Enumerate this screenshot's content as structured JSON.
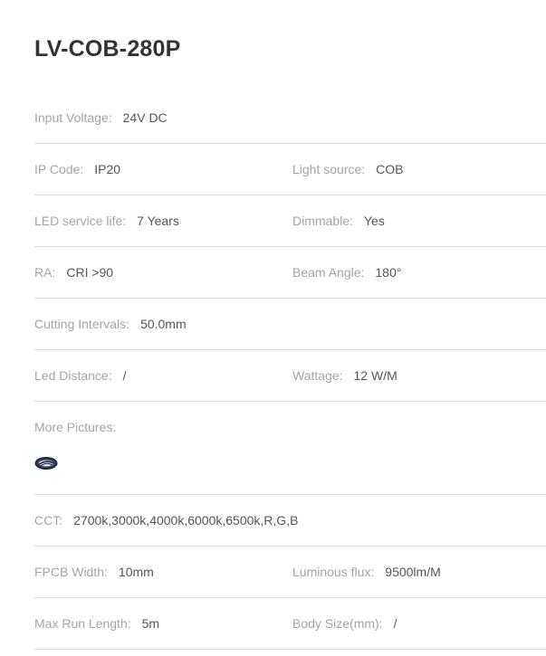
{
  "title": "LV-COB-280P",
  "rows": [
    {
      "left": {
        "label": "Input Voltage:",
        "value": "24V DC"
      }
    },
    {
      "left": {
        "label": "IP Code:",
        "value": "IP20"
      },
      "right": {
        "label": "Light source:",
        "value": "COB"
      }
    },
    {
      "left": {
        "label": "LED service life:",
        "value": "7 Years"
      },
      "right": {
        "label": "Dimmable:",
        "value": "Yes"
      }
    },
    {
      "left": {
        "label": "RA:",
        "value": "CRI >90"
      },
      "right": {
        "label": "Beam Angle:",
        "value": "180°"
      }
    },
    {
      "left": {
        "label": "Cutting Intervals:",
        "value": "50.0mm"
      }
    },
    {
      "left": {
        "label": "Led Distance:",
        "value": "/"
      },
      "right": {
        "label": "Wattage:",
        "value": "12 W/M"
      }
    },
    {
      "left": {
        "label": "More Pictures:"
      },
      "picture_icon": "cob-strip-thumbnail-icon"
    },
    {
      "left": {
        "label": "CCT:",
        "value": "2700k,3000k,4000k,6000k,6500k,R,G,B"
      }
    },
    {
      "left": {
        "label": "FPCB Width:",
        "value": "10mm"
      },
      "right": {
        "label": "Luminous flux:",
        "value": "9500lm/M"
      }
    },
    {
      "left": {
        "label": "Max Run Length:",
        "value": "5m"
      },
      "right": {
        "label": "Body Size(mm):",
        "value": "/"
      }
    }
  ]
}
